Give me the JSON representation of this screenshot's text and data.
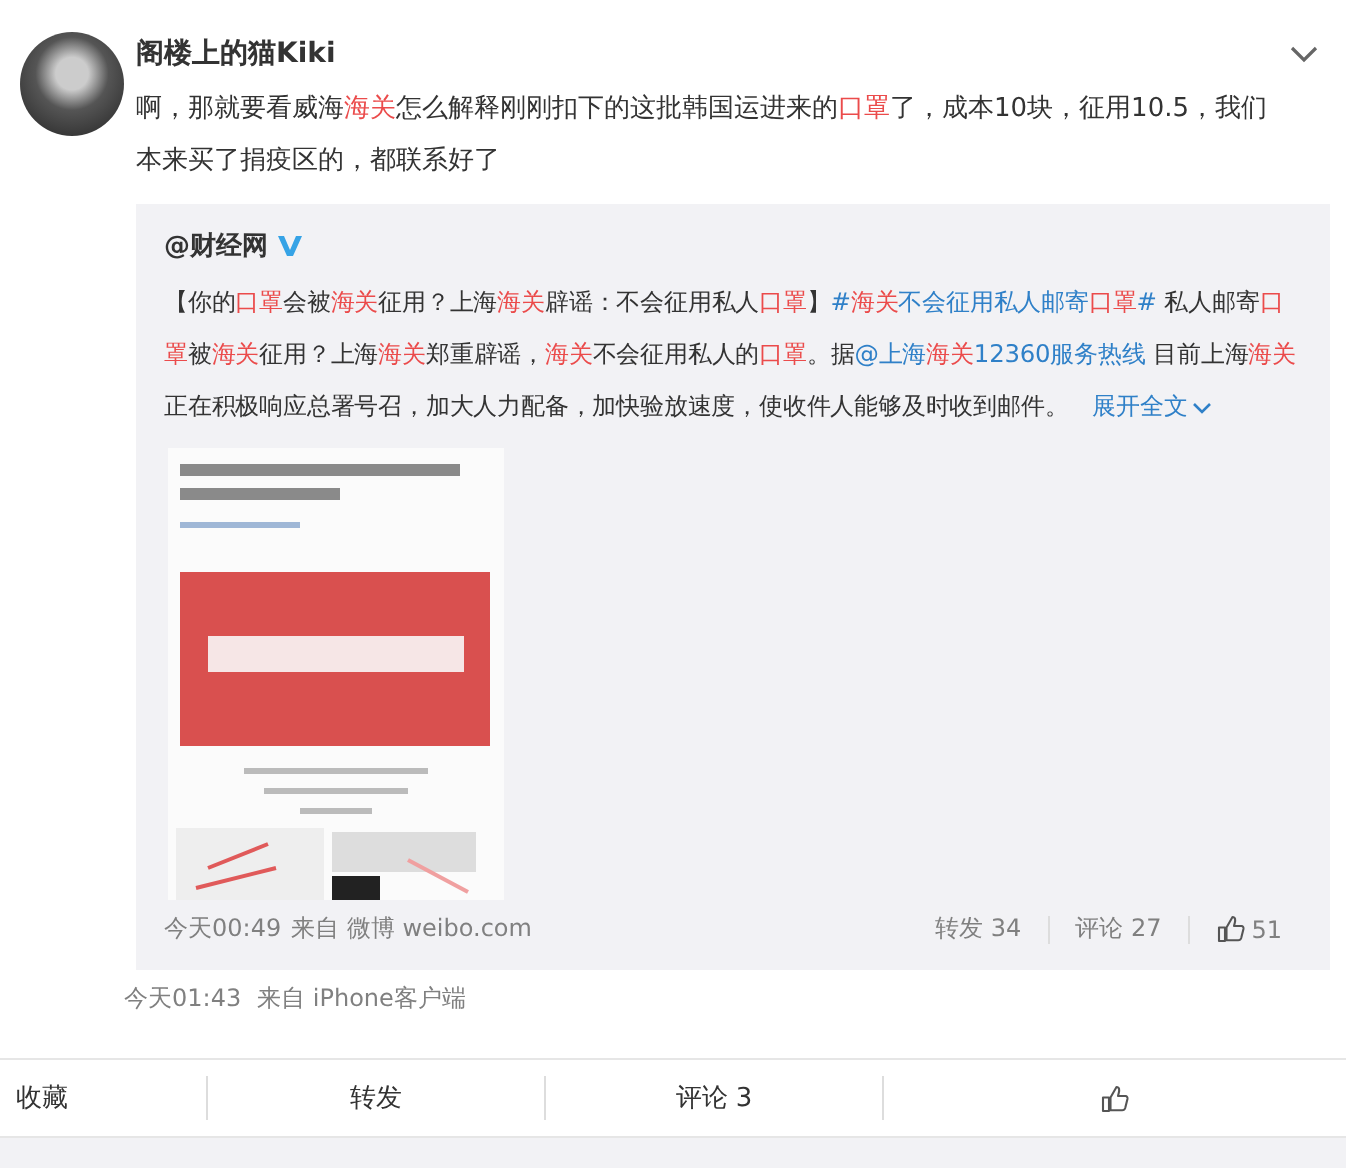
{
  "post": {
    "author": "阁楼上的猫Kiki",
    "text": [
      {
        "kind": "plain",
        "text": "啊，那就要看威海"
      },
      {
        "kind": "keyword",
        "text": "海关"
      },
      {
        "kind": "plain",
        "text": "怎么解释刚刚扣下的这批韩国运进来的"
      },
      {
        "kind": "keyword",
        "text": "口罩"
      },
      {
        "kind": "plain",
        "text": "了，成本10块，征用10.5，我们本来买了捐疫区的，都联系好了"
      }
    ],
    "time": "今天01:43",
    "source": "来自 iPhone客户端"
  },
  "repost": {
    "author": "@财经网",
    "verified": true,
    "text": [
      {
        "kind": "plain",
        "text": "【你的"
      },
      {
        "kind": "keyword",
        "text": "口罩"
      },
      {
        "kind": "plain",
        "text": "会被"
      },
      {
        "kind": "keyword",
        "text": "海关"
      },
      {
        "kind": "plain",
        "text": "征用？上海"
      },
      {
        "kind": "keyword",
        "text": "海关"
      },
      {
        "kind": "plain",
        "text": "辟谣：不会征用私人"
      },
      {
        "kind": "keyword",
        "text": "口罩"
      },
      {
        "kind": "plain",
        "text": "】"
      },
      {
        "kind": "link",
        "parts": [
          {
            "kind": "plain",
            "text": "#"
          },
          {
            "kind": "keyword",
            "text": "海关"
          },
          {
            "kind": "plain",
            "text": "不会征用私人邮寄"
          },
          {
            "kind": "keyword",
            "text": "口罩"
          },
          {
            "kind": "plain",
            "text": "#"
          }
        ]
      },
      {
        "kind": "plain",
        "text": " 私人邮寄"
      },
      {
        "kind": "keyword",
        "text": "口罩"
      },
      {
        "kind": "plain",
        "text": "被"
      },
      {
        "kind": "keyword",
        "text": "海关"
      },
      {
        "kind": "plain",
        "text": "征用？上海"
      },
      {
        "kind": "keyword",
        "text": "海关"
      },
      {
        "kind": "plain",
        "text": "郑重辟谣，"
      },
      {
        "kind": "keyword",
        "text": "海关"
      },
      {
        "kind": "plain",
        "text": "不会征用私人的"
      },
      {
        "kind": "keyword",
        "text": "口罩"
      },
      {
        "kind": "plain",
        "text": "。据"
      },
      {
        "kind": "link",
        "parts": [
          {
            "kind": "plain",
            "text": "@上海"
          },
          {
            "kind": "keyword",
            "text": "海关"
          },
          {
            "kind": "plain",
            "text": "12360服务热线"
          }
        ]
      },
      {
        "kind": "plain",
        "text": " 目前上海"
      },
      {
        "kind": "keyword",
        "text": "海关"
      },
      {
        "kind": "plain",
        "text": "正在积极响应总署号召，加大人力配备，加快验放速度，使收件人能够及时收到邮件。"
      }
    ],
    "expand": "展开全文",
    "time": "今天00:49",
    "source": "来自 微博 weibo.com",
    "reposts": "转发 34",
    "comments": "评论 27",
    "likes": "51"
  },
  "actions": [
    {
      "kind": "text",
      "label": "收藏"
    },
    {
      "kind": "text",
      "label": "转发"
    },
    {
      "kind": "text",
      "label": "评论 3"
    },
    {
      "kind": "like"
    }
  ]
}
